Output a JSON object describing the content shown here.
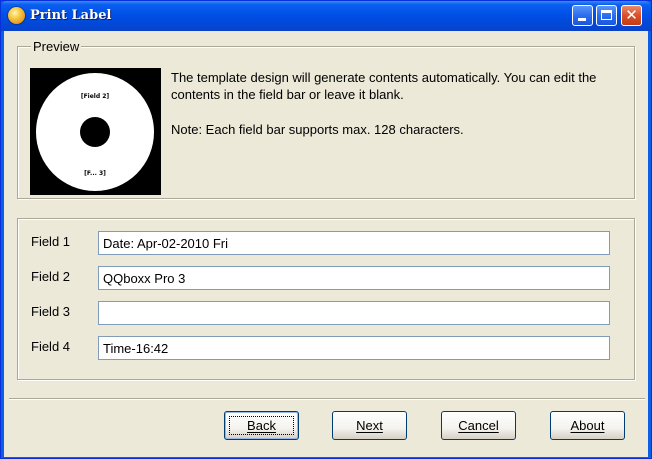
{
  "window": {
    "title": "Print Label",
    "icons": {
      "app": "disc-app-icon",
      "minimize": "minimize-icon",
      "maximize": "maximize-icon",
      "close": "close-icon"
    },
    "close_glyph": "✕"
  },
  "preview": {
    "legend": "Preview",
    "thumbnail": {
      "field_top": "[Field 2]",
      "field_bottom": "[F... 3]"
    },
    "description": "The template design will generate contents automatically.  You can edit the contents in the field bar or leave it blank.",
    "note": "Note: Each field bar supports max. 128 characters."
  },
  "fields": [
    {
      "label": "Field 1",
      "value": "Date: Apr-02-2010 Fri"
    },
    {
      "label": "Field 2",
      "value": "QQboxx Pro 3"
    },
    {
      "label": "Field 3",
      "value": ""
    },
    {
      "label": "Field 4",
      "value": "Time-16:42"
    }
  ],
  "buttons": {
    "back": "Back",
    "next": "Next",
    "cancel": "Cancel",
    "about": "About"
  },
  "colors": {
    "titlebar": "#0054e3",
    "dialog_background": "#ece9d8",
    "close_button": "#d9502a"
  }
}
